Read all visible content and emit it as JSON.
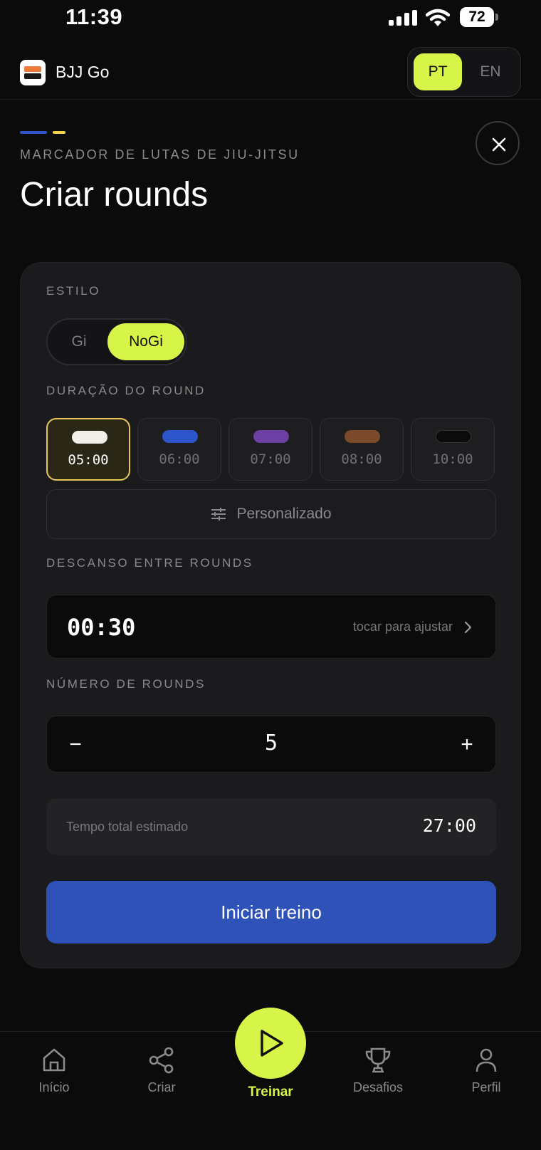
{
  "status_bar": {
    "time": "11:39",
    "battery": "72"
  },
  "header": {
    "app_name": "BJJ Go",
    "lang_options": [
      "PT",
      "EN"
    ],
    "lang_selected": "PT"
  },
  "page": {
    "eyebrow": "MARCADOR DE LUTAS DE JIU-JITSU",
    "title": "Criar rounds"
  },
  "form": {
    "style_label": "ESTILO",
    "style_options": [
      "Gi",
      "NoGi"
    ],
    "style_selected": "NoGi",
    "duration_label": "DURAÇÃO DO ROUND",
    "durations": [
      {
        "value": "05:00",
        "belt_color": "#f2efe8"
      },
      {
        "value": "06:00",
        "belt_color": "#2c55c9"
      },
      {
        "value": "07:00",
        "belt_color": "#6b3fa3"
      },
      {
        "value": "08:00",
        "belt_color": "#7a4a2a"
      },
      {
        "value": "10:00",
        "belt_color": "#0b0b0c"
      }
    ],
    "duration_selected": "05:00",
    "custom_label": "Personalizado",
    "rest_label": "DESCANSO ENTRE ROUNDS",
    "rest_value": "00:30",
    "rest_hint": "tocar para ajustar",
    "rounds_label": "NÚMERO DE ROUNDS",
    "rounds_minus": "−",
    "rounds_value": "5",
    "rounds_plus": "+",
    "total_label": "Tempo total estimado",
    "total_value": "27:00",
    "start_label": "Iniciar treino"
  },
  "nav": {
    "items": [
      {
        "label": "Início",
        "icon": "home-icon"
      },
      {
        "label": "Criar",
        "icon": "share-icon"
      },
      {
        "label": "Treinar",
        "icon": "play-icon"
      },
      {
        "label": "Desafios",
        "icon": "trophy-icon"
      },
      {
        "label": "Perfil",
        "icon": "user-icon"
      }
    ],
    "active": "Treinar"
  },
  "colors": {
    "accent_lime": "#d6f548",
    "primary_blue": "#2f52b8",
    "selected_gold": "#e8c65a"
  }
}
